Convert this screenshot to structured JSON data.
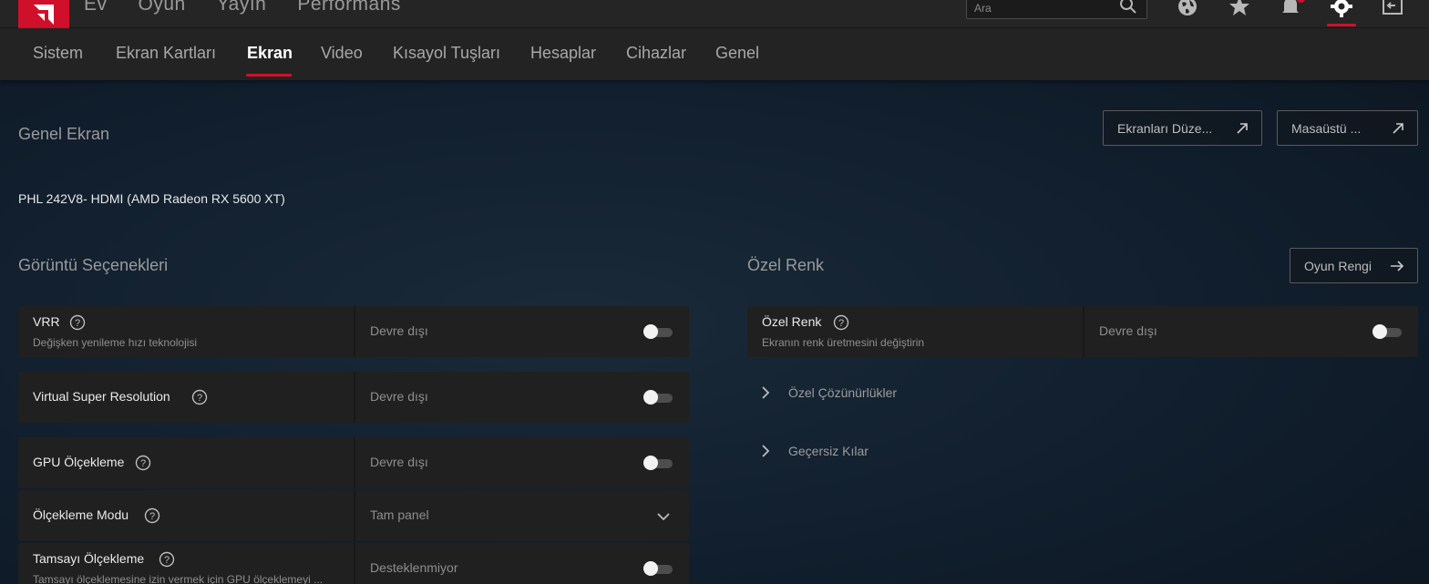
{
  "top_nav": {
    "items": [
      "Ev",
      "Oyun",
      "Yayın",
      "Performans"
    ]
  },
  "search": {
    "placeholder": "Ara"
  },
  "top_icons": [
    "globe-icon",
    "star-icon",
    "bell-icon",
    "gear-icon",
    "exit-icon"
  ],
  "sub_nav": {
    "tabs": [
      "Sistem",
      "Ekran Kartları",
      "Ekran",
      "Video",
      "Kısayol Tuşları",
      "Hesaplar",
      "Cihazlar",
      "Genel"
    ],
    "active": "Ekran"
  },
  "general_display": {
    "title": "Genel Ekran",
    "arrange_button": "Ekranları Düze...",
    "desktop_button": "Masaüstü ...",
    "monitor": "PHL 242V8- HDMI (AMD Radeon RX 5600 XT)"
  },
  "display_options": {
    "title": "Görüntü Seçenekleri",
    "rows": [
      {
        "name": "VRR",
        "desc": "Değişken yenileme hızı teknolojisi",
        "value": "Devre dışı",
        "control": "toggle",
        "on": false
      },
      {
        "name": "Virtual Super Resolution",
        "desc": "",
        "value": "Devre dışı",
        "control": "toggle",
        "on": false
      },
      {
        "name": "GPU Ölçekleme",
        "desc": "",
        "value": "Devre dışı",
        "control": "toggle",
        "on": false
      },
      {
        "name": "Ölçekleme Modu",
        "desc": "",
        "value": "Tam panel",
        "control": "dropdown"
      },
      {
        "name": "Tamsayı Ölçekleme",
        "desc": "Tamsayı ölçeklemesine izin vermek için GPU ölçeklemeyi ...",
        "value": "Desteklenmiyor",
        "control": "toggle",
        "on": false
      }
    ]
  },
  "custom_color": {
    "title": "Özel Renk",
    "game_color_button": "Oyun Rengi",
    "row": {
      "name": "Özel Renk",
      "desc": "Ekranın renk üretmesini değiştirin",
      "value": "Devre dışı",
      "on": false
    },
    "expanders": [
      "Özel Çözünürlükler",
      "Geçersiz Kılar"
    ]
  },
  "colors": {
    "accent": "#d0102a",
    "topbar": "#252525",
    "panel": "#202020"
  }
}
